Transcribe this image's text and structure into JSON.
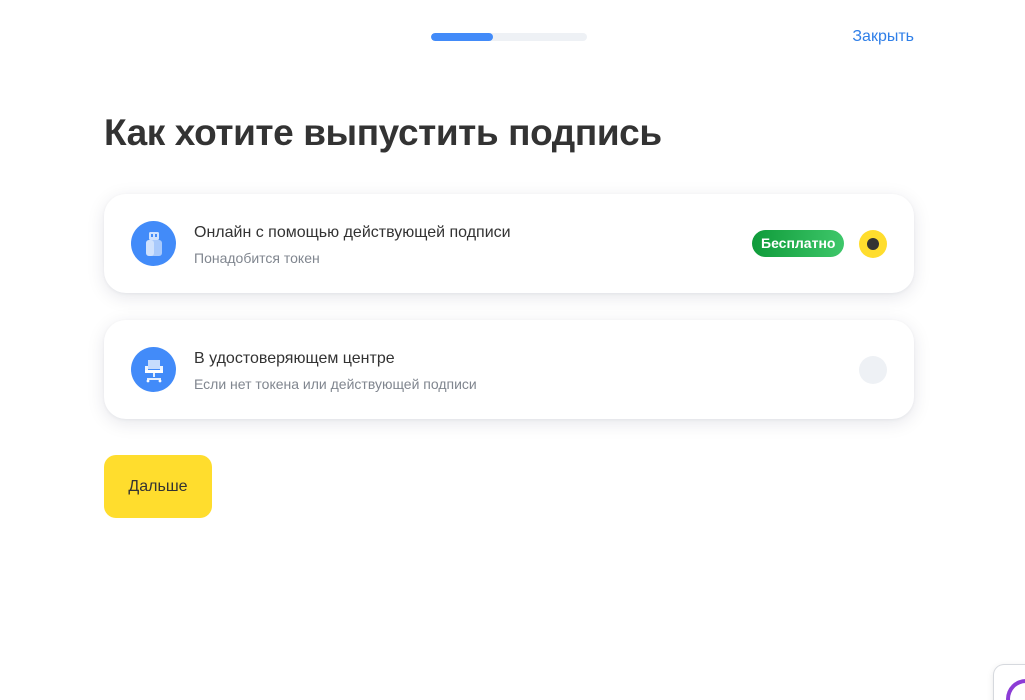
{
  "header": {
    "progress_percent": 40,
    "close_label": "Закрыть"
  },
  "page": {
    "title": "Как хотите выпустить подпись"
  },
  "options": [
    {
      "title": "Онлайн с помощью действующей подписи",
      "subtitle": "Понадобится токен",
      "badge": "Бесплатно",
      "selected": true,
      "icon": "usb-token-icon"
    },
    {
      "title": "В удостоверяющем центре",
      "subtitle": "Если нет токена или действующей подписи",
      "selected": false,
      "icon": "office-chair-icon"
    }
  ],
  "actions": {
    "next_label": "Дальше"
  },
  "colors": {
    "accent_blue": "#428bf9",
    "link_blue": "#2f7fe8",
    "primary_yellow": "#ffdd2d",
    "badge_green": "#0f9b3a",
    "text_dark": "#333333",
    "text_muted": "#80868f",
    "track_gray": "#eef1f5"
  }
}
